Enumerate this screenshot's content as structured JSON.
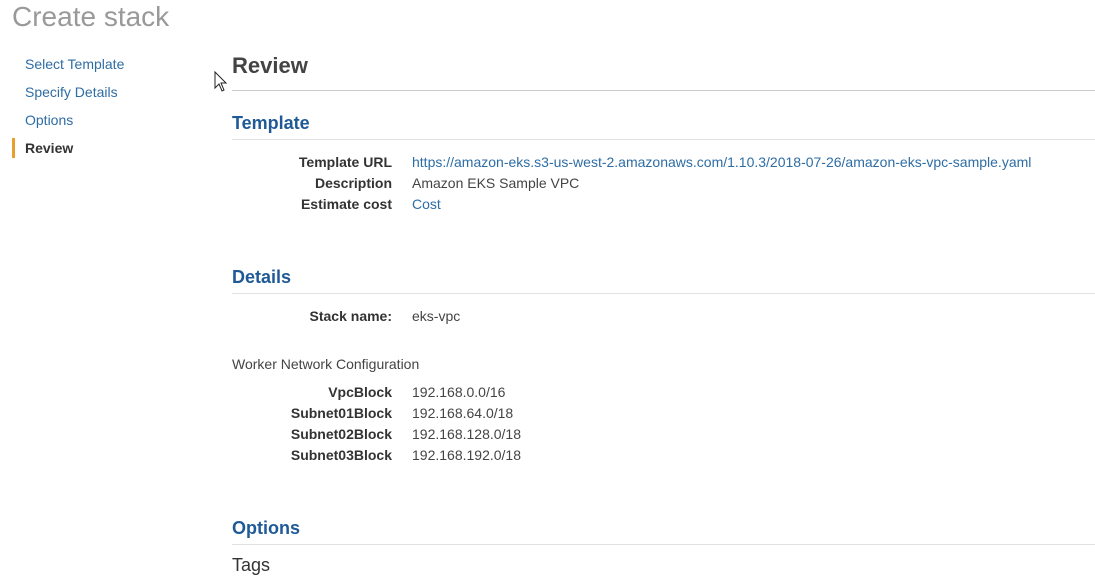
{
  "page": {
    "title": "Create stack"
  },
  "nav": {
    "items": [
      {
        "label": "Select Template",
        "active": false
      },
      {
        "label": "Specify Details",
        "active": false
      },
      {
        "label": "Options",
        "active": false
      },
      {
        "label": "Review",
        "active": true
      }
    ],
    "accent_color": "#e7a02e"
  },
  "main": {
    "heading": "Review",
    "template": {
      "title": "Template",
      "rows": [
        {
          "key": "Template URL",
          "value": "https://amazon-eks.s3-us-west-2.amazonaws.com/1.10.3/2018-07-26/amazon-eks-vpc-sample.yaml",
          "link": true
        },
        {
          "key": "Description",
          "value": "Amazon EKS Sample VPC",
          "link": false
        },
        {
          "key": "Estimate cost",
          "value": "Cost",
          "link": true
        }
      ]
    },
    "details": {
      "title": "Details",
      "stack_name_label": "Stack name:",
      "stack_name": "eks-vpc",
      "group_title": "Worker Network Configuration",
      "params": [
        {
          "key": "VpcBlock",
          "value": "192.168.0.0/16"
        },
        {
          "key": "Subnet01Block",
          "value": "192.168.64.0/18"
        },
        {
          "key": "Subnet02Block",
          "value": "192.168.128.0/18"
        },
        {
          "key": "Subnet03Block",
          "value": "192.168.192.0/18"
        }
      ]
    },
    "options": {
      "title": "Options",
      "tags_heading": "Tags"
    }
  }
}
